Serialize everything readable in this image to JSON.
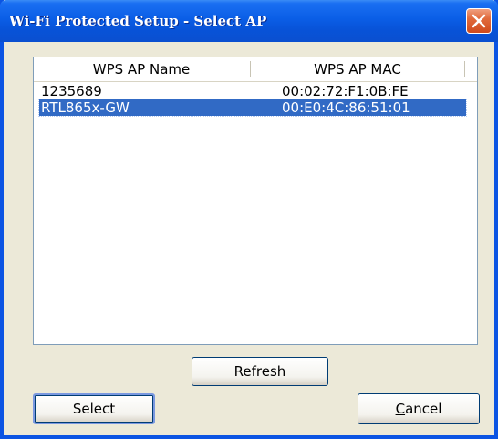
{
  "window": {
    "title": "Wi-Fi Protected Setup - Select AP"
  },
  "list": {
    "columns": [
      "WPS AP Name",
      "WPS AP MAC"
    ],
    "rows": [
      {
        "name": "1235689",
        "mac": "00:02:72:F1:0B:FE",
        "selected": false
      },
      {
        "name": "RTL865x-GW",
        "mac": "00:E0:4C:86:51:01",
        "selected": true
      }
    ]
  },
  "buttons": {
    "refresh": "Refresh",
    "select": "Select",
    "cancel_mnemonic": "C",
    "cancel_rest": "ancel"
  },
  "icons": {
    "close": "close-icon"
  },
  "colors": {
    "titlebar": "#0a5ee6",
    "selection": "#316ac5",
    "close_button": "#e06a3c",
    "dialog_face": "#ece9d8"
  }
}
